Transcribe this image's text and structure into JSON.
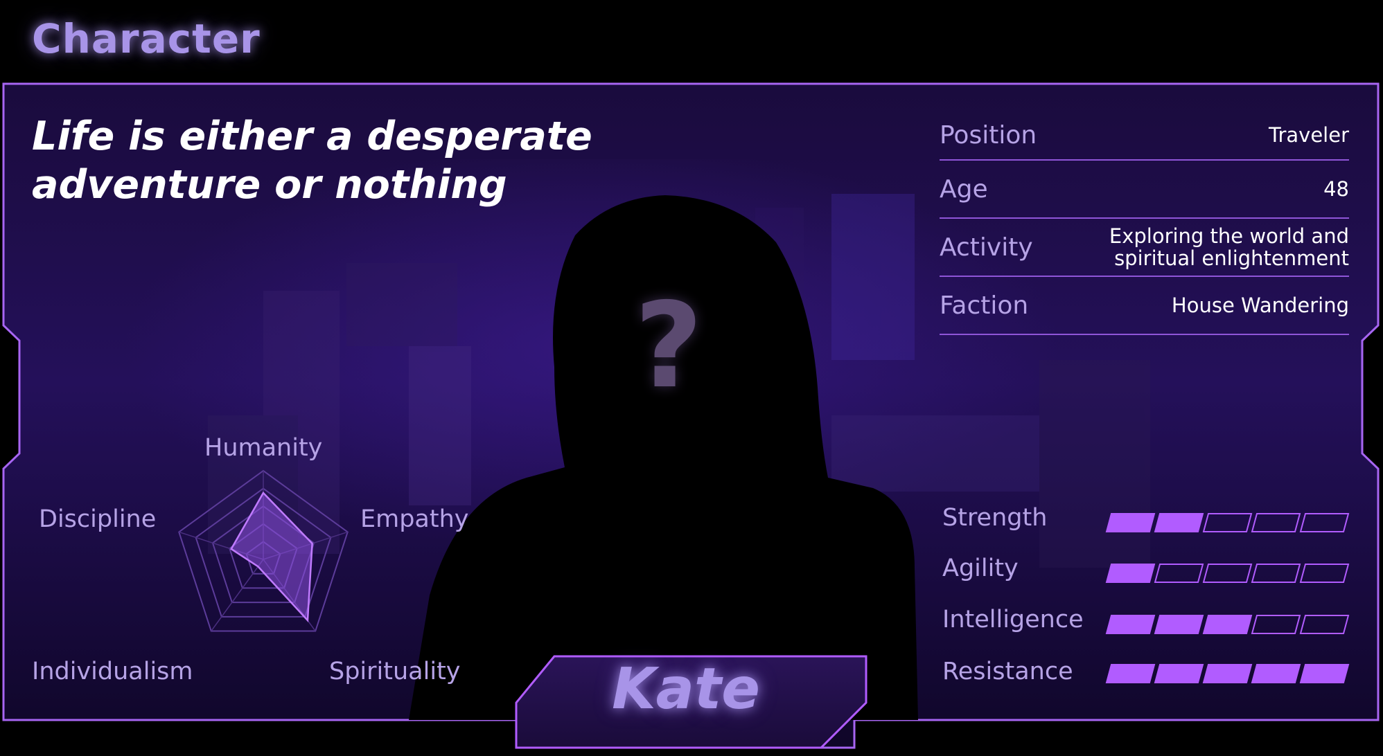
{
  "page": {
    "title": "Character"
  },
  "quote": {
    "line1": "Life is either a desperate",
    "line2": "adventure or nothing"
  },
  "info": [
    {
      "label": "Position",
      "value": "Traveler"
    },
    {
      "label": "Age",
      "value": "48"
    },
    {
      "label": "Activity",
      "value_line1": "Exploring the world and",
      "value_line2": "spiritual enlightenment"
    },
    {
      "label": "Faction",
      "value": "House Wandering"
    }
  ],
  "stats": [
    {
      "label": "Strength",
      "level": 2,
      "max": 5
    },
    {
      "label": "Agility",
      "level": 1,
      "max": 5
    },
    {
      "label": "Intelligence",
      "level": 3,
      "max": 5
    },
    {
      "label": "Resistance",
      "level": 5,
      "max": 5
    }
  ],
  "radar": {
    "labels": {
      "humanity": "Humanity",
      "empathy": "Empathy",
      "spirituality": "Spirituality",
      "individualism": "Individualism",
      "discipline": "Discipline"
    },
    "values": {
      "humanity": 0.75,
      "empathy": 0.58,
      "spirituality": 0.85,
      "individualism": 0.1,
      "discipline": 0.38
    },
    "rings": 5
  },
  "character": {
    "name": "Kate",
    "portrait": "?"
  },
  "colors": {
    "accent": "#b15cff",
    "label": "#b6a3e6",
    "title": "#a894e8",
    "panel": "#1b0b3a"
  }
}
